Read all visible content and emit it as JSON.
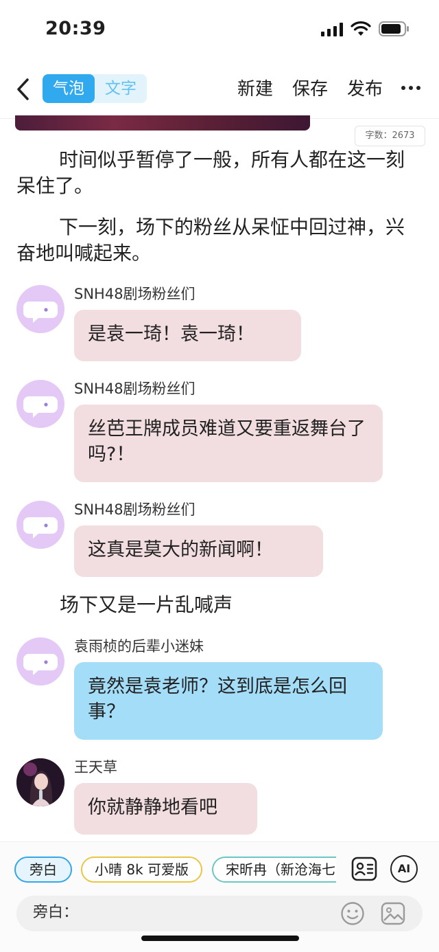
{
  "status": {
    "time": "20:39"
  },
  "header": {
    "tabs": [
      {
        "label": "气泡",
        "active": true
      },
      {
        "label": "文字",
        "active": false
      }
    ],
    "new_label": "新建",
    "save_label": "保存",
    "publish_label": "发布"
  },
  "article": {
    "word_count": "字数：2673",
    "paragraphs": [
      "时间似乎暂停了一般，所有人都在这一刻呆住了。",
      "下一刻，场下的粉丝从呆怔中回过神，兴奋地叫喊起来。"
    ]
  },
  "messages": [
    {
      "sender": "SNH48剧场粉丝们",
      "text": "是袁一琦！袁一琦！"
    },
    {
      "sender": "SNH48剧场粉丝们",
      "text": "丝芭王牌成员难道又要重返舞台了吗?！"
    },
    {
      "sender": "SNH48剧场粉丝们",
      "text": "这真是莫大的新闻啊！"
    },
    {
      "narration": "场下又是一片乱喊声"
    },
    {
      "sender": "袁雨桢的后辈小迷妹",
      "text": "竟然是袁老师？这到底是怎么回事？"
    },
    {
      "sender": "王天草",
      "text": "你就静静地看吧"
    }
  ],
  "composer": {
    "roles": [
      "旁白",
      "小晴 8k 可爱版",
      "宋昕冉（新沧海七"
    ],
    "input_label": "旁白：",
    "ai_label": "AI"
  },
  "colors": {
    "accent": "#30a9ef",
    "bubble_pink": "#f2dde0",
    "bubble_blue": "#a4ddf8",
    "avatar_purple": "#e4c9f6"
  }
}
